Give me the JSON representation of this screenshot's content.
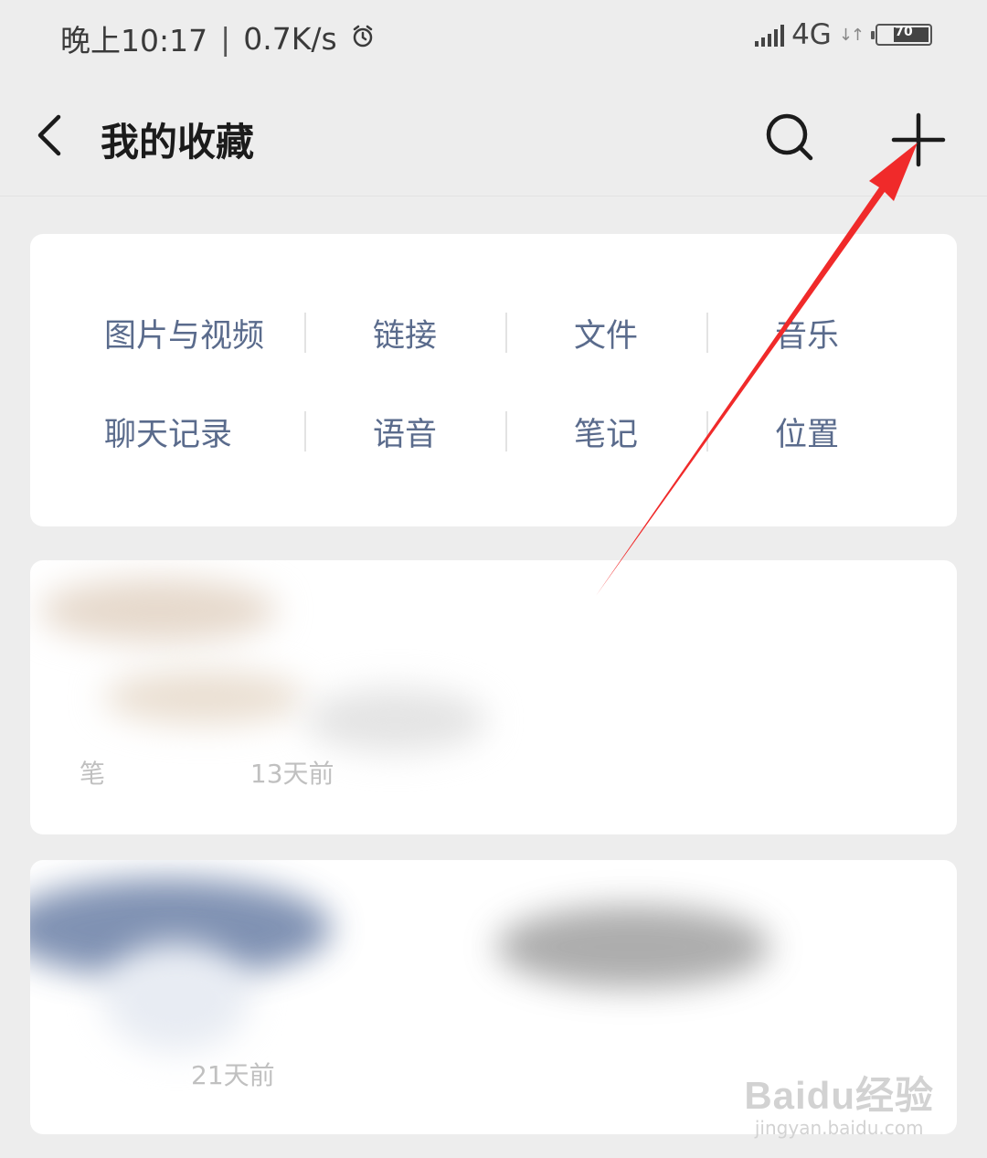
{
  "status_bar": {
    "time": "晚上10:17",
    "separator": "|",
    "net_speed": "0.7K/s",
    "alarm_icon": "alarm-clock-icon",
    "network": "4G",
    "battery_level": "70",
    "battery_percent": 70
  },
  "header": {
    "title": "我的收藏",
    "back_icon": "chevron-left-icon",
    "search_icon": "search-icon",
    "add_icon": "plus-icon"
  },
  "categories": {
    "row1": [
      "图片与视频",
      "链接",
      "文件",
      "音乐"
    ],
    "row2": [
      "聊天记录",
      "语音",
      "笔记",
      "位置"
    ]
  },
  "items": [
    {
      "meta": "笔",
      "time": "13天前"
    },
    {
      "meta": "",
      "time": "21天前"
    }
  ],
  "annotation": {
    "color": "#f02a2a"
  },
  "watermark": {
    "logo": "Baidu经验",
    "url": "jingyan.baidu.com"
  },
  "colors": {
    "category_text": "#5a6b8c",
    "background": "#ededed",
    "card": "#ffffff"
  }
}
